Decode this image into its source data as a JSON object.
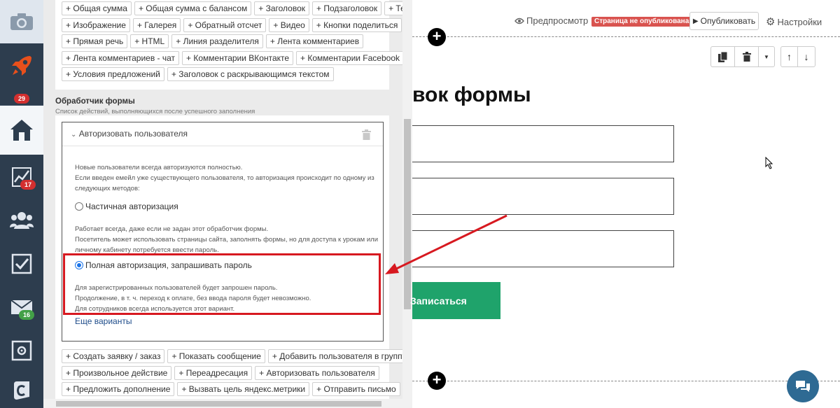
{
  "nav": {
    "items": [
      {
        "icon": "camera-icon"
      },
      {
        "icon": "rocket-icon",
        "badge": "29"
      },
      {
        "icon": "home-icon"
      },
      {
        "icon": "chart-icon",
        "badge": "17"
      },
      {
        "icon": "users-icon"
      },
      {
        "icon": "checkbox-icon"
      },
      {
        "icon": "mail-icon",
        "badge": "16"
      },
      {
        "icon": "safe-icon"
      },
      {
        "icon": "logo-icon"
      }
    ],
    "badges": {
      "rocket": "29",
      "chart": "17",
      "mail": "16"
    }
  },
  "blocks": {
    "rows": [
      [
        "+ Общая сумма",
        "+ Общая сумма с балансом",
        "+ Заголовок",
        "+ Подзаголовок",
        "+ Текст"
      ],
      [
        "+ Изображение",
        "+ Галерея",
        "+ Обратный отсчет",
        "+ Видео",
        "+ Кнопки поделиться"
      ],
      [
        "+ Прямая речь",
        "+ HTML",
        "+ Линия разделителя",
        "+ Лента комментариев"
      ],
      [
        "+ Лента комментариев - чат",
        "+ Комментарии ВКонтакте",
        "+ Комментарии Facebook"
      ],
      [
        "+ Условия предложений",
        "+ Заголовок с раскрывающимся текстом"
      ]
    ]
  },
  "handler": {
    "section_title": "Обработчик формы",
    "section_subtitle": "Список действий, выполняющихся после успешного заполнения",
    "title": "Авторизовать пользователя",
    "intro_lines": [
      "Новые пользователи всегда авторизуются полностью.",
      "Если введен емейл уже существующего пользователя, то авторизация происходит по одному из",
      "следующих методов:"
    ],
    "option_partial": "Частичная авторизация",
    "partial_lines": [
      "Работает всегда, даже если не задан этот обработчик формы.",
      "Посетитель может использовать страницы сайта, заполнять формы, но для доступа к урокам или",
      "личному кабинету потребуется ввести пароль."
    ],
    "option_full": "Полная авторизация, запрашивать пароль",
    "full_lines": [
      "Для зарегистрированных пользователей будет запрошен пароль.",
      "Продолжение, в т. ч. переход к оплате, без ввода пароля будет невозможно.",
      "Для сотрудников всегда используется этот вариант."
    ],
    "more_link": "Еще варианты",
    "selected_option": "full"
  },
  "actions": {
    "rows": [
      [
        "+ Создать заявку / заказ",
        "+ Показать сообщение",
        "+ Добавить пользователя в группу"
      ],
      [
        "+ Произвольное действие",
        "+ Переадресация",
        "+ Авторизовать пользователя"
      ],
      [
        "+ Предложить дополнение",
        "+ Вызвать цель яндекс.метрики",
        "+ Отправить письмо"
      ]
    ]
  },
  "toolbar": {
    "preview": "Предпросмотр",
    "status_badge": "Страница не опубликована",
    "publish": "Опубликовать",
    "settings": "Настройки"
  },
  "form": {
    "title": "вок формы",
    "submit": "Записаться"
  },
  "colors": {
    "nav_bg": "#2d3d4e",
    "accent_green": "#1fa36b",
    "highlight_red": "#d71920",
    "badge_red": "#d32f2f",
    "badge_green": "#43a047",
    "chat_blue": "#2e6a93"
  }
}
